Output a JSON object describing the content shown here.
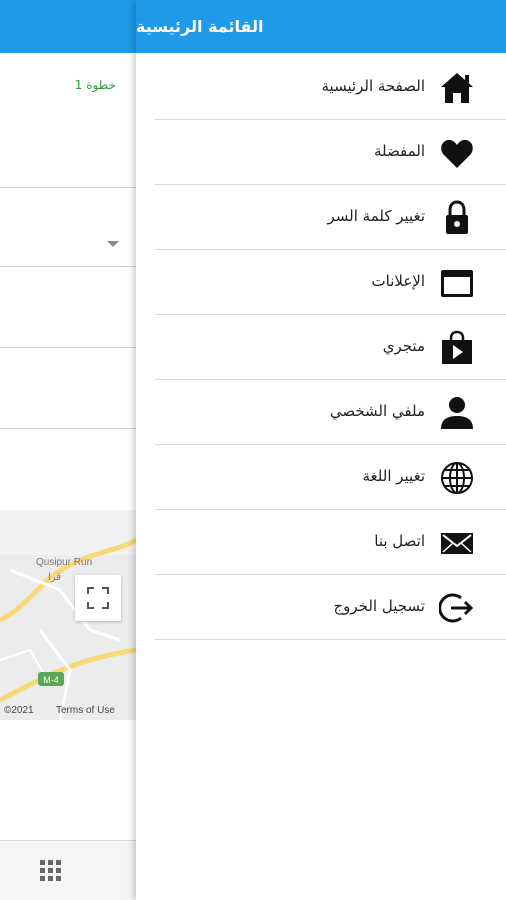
{
  "background_page": {
    "step_label": "خطوة 1",
    "map": {
      "place_label": "Qusipur Run",
      "arabic_label": "قرا",
      "road_shield": "M-4",
      "copyright": "©2021",
      "terms": "Terms of Use",
      "fullscreen_icon": "fullscreen-icon"
    },
    "bottom_icon": "grid-icon"
  },
  "drawer": {
    "title": "القائمة الرئيسية",
    "items": [
      {
        "label": "الصفحة الرئيسية",
        "icon": "home-icon"
      },
      {
        "label": "المفضلة",
        "icon": "heart-icon"
      },
      {
        "label": "تغيير كلمة السر",
        "icon": "lock-icon"
      },
      {
        "label": "الإعلانات",
        "icon": "window-icon"
      },
      {
        "label": "متجري",
        "icon": "shopping-bag-icon"
      },
      {
        "label": "ملفي الشخصي",
        "icon": "person-icon"
      },
      {
        "label": "تغيير اللغة",
        "icon": "globe-icon"
      },
      {
        "label": "اتصل بنا",
        "icon": "envelope-icon"
      },
      {
        "label": "تسجيل الخروج",
        "icon": "logout-icon"
      }
    ]
  },
  "colors": {
    "primary": "#1e9ae8",
    "step_green": "#2e9a3e"
  }
}
